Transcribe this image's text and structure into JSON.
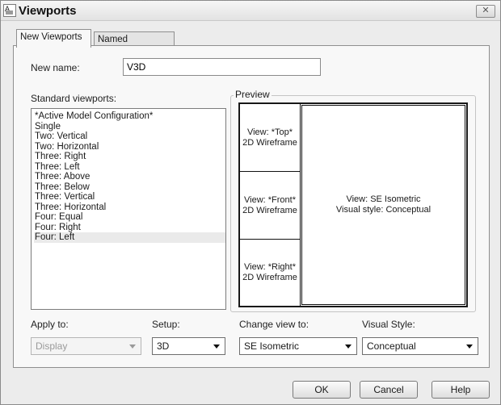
{
  "window": {
    "title": "Viewports",
    "icon": "app-logo-icon",
    "close_icon": "close-icon",
    "close_glyph": "✕"
  },
  "tabs": [
    {
      "label": "New Viewports",
      "active": true
    },
    {
      "label": "Named Viewports",
      "active": false
    }
  ],
  "new_name": {
    "label": "New name:",
    "value": "V3D"
  },
  "standard_viewports": {
    "label": "Standard viewports:",
    "items": [
      "*Active Model Configuration*",
      "Single",
      "Two:  Vertical",
      "Two:  Horizontal",
      "Three: Right",
      "Three: Left",
      "Three: Above",
      "Three: Below",
      "Three: Vertical",
      "Three: Horizontal",
      "Four:  Equal",
      "Four:  Right",
      "Four:  Left"
    ],
    "selected": "Four:  Left"
  },
  "preview": {
    "label": "Preview",
    "panes": [
      {
        "view": "View: *Top*",
        "style": "2D Wireframe"
      },
      {
        "view": "View: *Front*",
        "style": "2D Wireframe"
      },
      {
        "view": "View: *Right*",
        "style": "2D Wireframe"
      },
      {
        "view": "View: SE Isometric",
        "style": "Visual style: Conceptual"
      }
    ]
  },
  "apply_to": {
    "label": "Apply to:",
    "value": "Display",
    "enabled": false
  },
  "setup": {
    "label": "Setup:",
    "value": "3D"
  },
  "change_view": {
    "label": "Change view to:",
    "value": "SE Isometric"
  },
  "visual_style": {
    "label": "Visual Style:",
    "value": "Conceptual"
  },
  "buttons": {
    "ok": "OK",
    "cancel": "Cancel",
    "help": "Help"
  }
}
